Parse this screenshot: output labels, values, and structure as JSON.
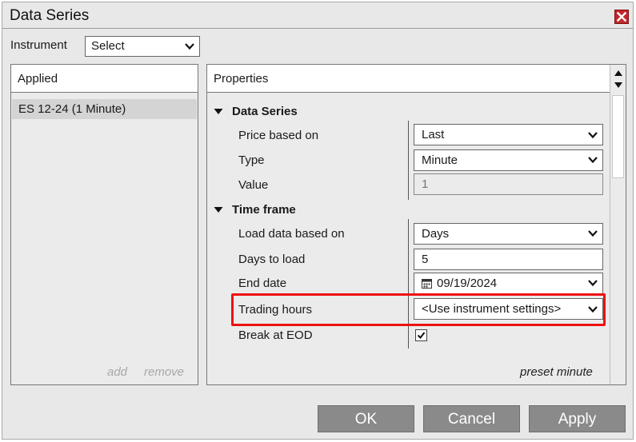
{
  "window": {
    "title": "Data Series"
  },
  "instrument": {
    "label": "Instrument",
    "selected": "Select"
  },
  "applied": {
    "header": "Applied",
    "items": [
      "ES 12-24 (1 Minute)"
    ],
    "add_label": "add",
    "remove_label": "remove"
  },
  "properties": {
    "header": "Properties",
    "sections": [
      {
        "title": "Data Series",
        "rows": [
          {
            "label": "Price based on",
            "value": "Last"
          },
          {
            "label": "Type",
            "value": "Minute"
          },
          {
            "label": "Value",
            "value": "1"
          }
        ]
      },
      {
        "title": "Time frame",
        "rows": [
          {
            "label": "Load data based on",
            "value": "Days"
          },
          {
            "label": "Days to load",
            "value": "5"
          },
          {
            "label": "End date",
            "value": "09/19/2024"
          },
          {
            "label": "Trading hours",
            "value": "<Use instrument settings>"
          },
          {
            "label": "Break at EOD",
            "checked": true
          }
        ]
      }
    ],
    "preset_label": "preset minute"
  },
  "buttons": {
    "ok": "OK",
    "cancel": "Cancel",
    "apply": "Apply"
  },
  "colors": {
    "highlight": "#ee1111",
    "close_button": "#c3272b",
    "button_bg": "#8a8a8a"
  },
  "icons": {
    "close": "close-icon",
    "dropdown": "chevron-down-icon",
    "collapse": "triangle-down-icon",
    "calendar": "calendar-icon",
    "check": "checkmark-icon",
    "scroll_up": "arrow-up-icon",
    "scroll_down": "arrow-down-icon"
  }
}
